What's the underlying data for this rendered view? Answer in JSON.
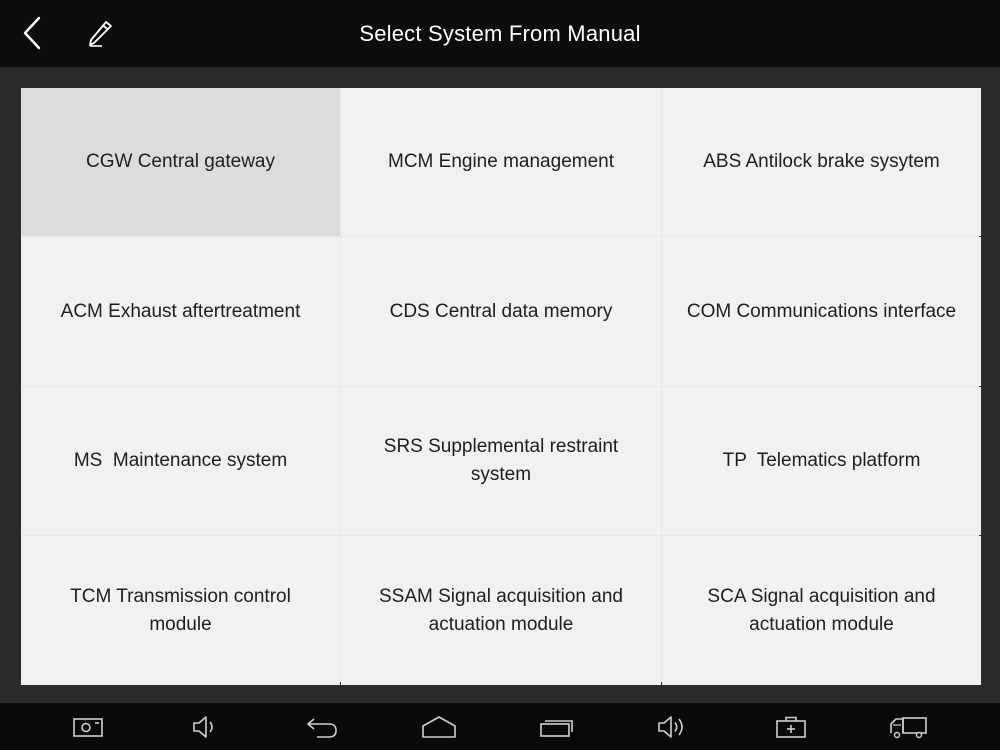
{
  "header": {
    "title": "Select System From Manual",
    "back_icon": "chevron-left-icon",
    "edit_icon": "pencil-icon"
  },
  "systems": [
    {
      "label": "CGW Central gateway",
      "selected": true
    },
    {
      "label": "MCM Engine management",
      "selected": false
    },
    {
      "label": "ABS Antilock brake sysytem",
      "selected": false
    },
    {
      "label": "ACM Exhaust aftertreatment",
      "selected": false
    },
    {
      "label": "CDS Central data memory",
      "selected": false
    },
    {
      "label": "COM Communications interface",
      "selected": false
    },
    {
      "label": "MS  Maintenance system",
      "selected": false
    },
    {
      "label": "SRS Supplemental restraint\nsystem",
      "selected": false
    },
    {
      "label": "TP  Telematics platform",
      "selected": false
    },
    {
      "label": "TCM Transmission control\nmodule",
      "selected": false
    },
    {
      "label": "SSAM Signal acquisition and\nactuation module",
      "selected": false
    },
    {
      "label": "SCA Signal acquisition and\nactuation module",
      "selected": false
    }
  ],
  "navbar": {
    "icons": [
      "screenshot-icon",
      "volume-down-icon",
      "back-icon",
      "home-icon",
      "recent-apps-icon",
      "volume-up-icon",
      "toolbox-icon",
      "vehicle-icon"
    ]
  },
  "colors": {
    "titlebar_bg": "#0d0d0d",
    "content_bg": "#2b2b2b",
    "cell_bg": "#f1f1f1",
    "cell_selected_bg": "#dcdcdc",
    "navbar_bg": "#0a0a0a"
  }
}
